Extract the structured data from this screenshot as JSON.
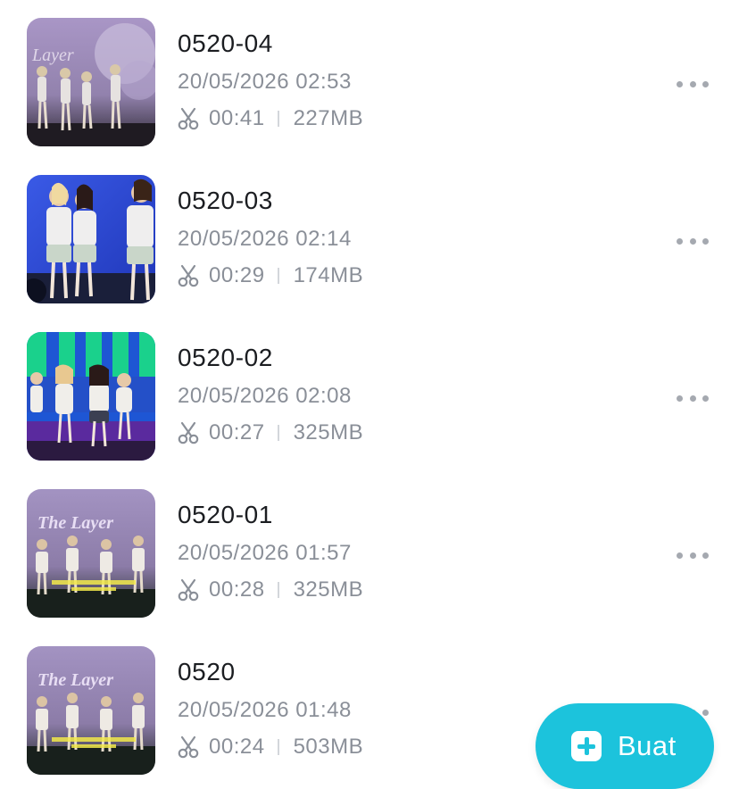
{
  "projects": [
    {
      "title": "0520-04",
      "datetime": "20/05/2026 02:53",
      "duration": "00:41",
      "size": "227MB",
      "thumbnail": {
        "palette": [
          "#9a86b8",
          "#c8b8dc",
          "#3a3040"
        ],
        "theme": "stage-purple"
      }
    },
    {
      "title": "0520-03",
      "datetime": "20/05/2026 02:14",
      "duration": "00:29",
      "size": "174MB",
      "thumbnail": {
        "palette": [
          "#2c4bd6",
          "#5a78f0",
          "#e8e8e8"
        ],
        "theme": "stage-blue"
      }
    },
    {
      "title": "0520-02",
      "datetime": "20/05/2026 02:08",
      "duration": "00:27",
      "size": "325MB",
      "thumbnail": {
        "palette": [
          "#19c690",
          "#1f5fd8",
          "#7a2db0"
        ],
        "theme": "stage-green-stripes"
      }
    },
    {
      "title": "0520-01",
      "datetime": "20/05/2026 01:57",
      "duration": "00:28",
      "size": "325MB",
      "thumbnail": {
        "palette": [
          "#8f7fae",
          "#c2b3d8",
          "#202a28"
        ],
        "theme": "stage-purple-subtitle"
      }
    },
    {
      "title": "0520",
      "datetime": "20/05/2026 01:48",
      "duration": "00:24",
      "size": "503MB",
      "thumbnail": {
        "palette": [
          "#8f7fae",
          "#c2b3d8",
          "#202a28"
        ],
        "theme": "stage-purple-subtitle"
      }
    }
  ],
  "fab": {
    "label": "Buat",
    "color": "#1cc3dc"
  },
  "icons": {
    "trim": "scissors-icon",
    "more": "more-icon",
    "create": "plus-icon"
  }
}
